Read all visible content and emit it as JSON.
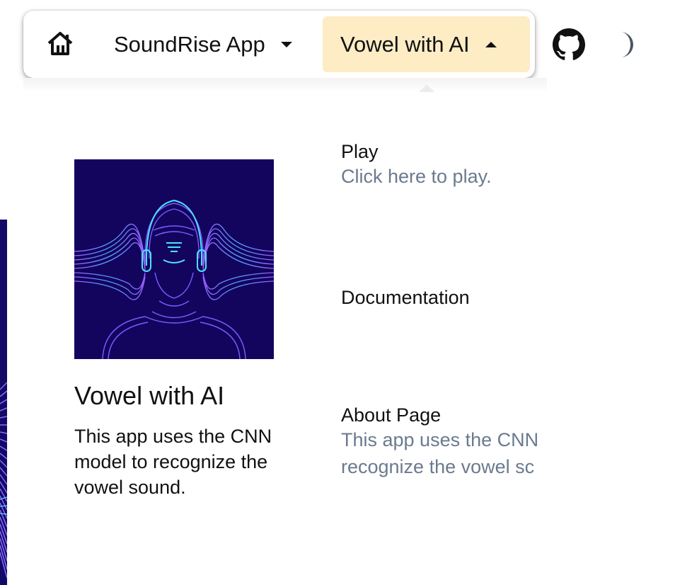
{
  "nav": {
    "home_icon": "home-icon",
    "soundrise_label": "SoundRise App",
    "vowel_label": "Vowel with AI",
    "github_icon": "github-icon",
    "theme_icon": "moon-icon",
    "active_bg": "#fdecc4"
  },
  "card": {
    "title": "Vowel with AI",
    "description": "This app uses the CNN model to recognize the vowel sound."
  },
  "menu": {
    "items": [
      {
        "title": "Play",
        "subtitle": "Click here to play."
      },
      {
        "title": "Documentation",
        "subtitle": ""
      },
      {
        "title": "About Page",
        "subtitle_line1": "This app uses the CNN",
        "subtitle_line2": "recognize the vowel sc"
      }
    ]
  },
  "colors": {
    "subtitle": "#6b7a8f",
    "image_bg": "#13055e"
  }
}
